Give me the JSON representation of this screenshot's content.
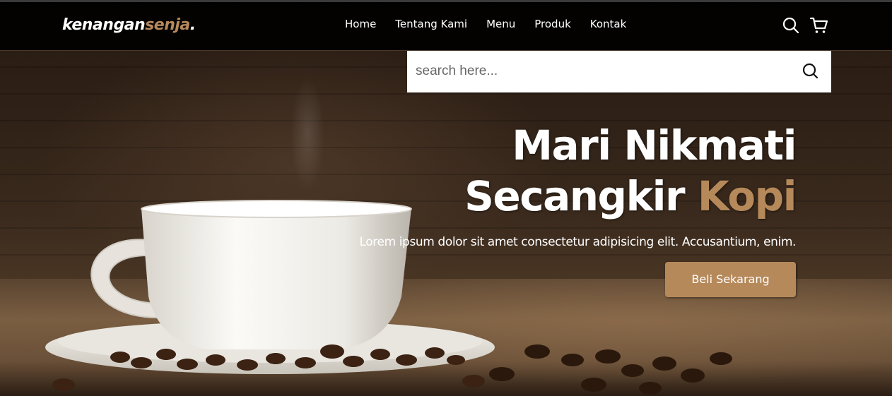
{
  "brand": {
    "name_part1": "kenangan",
    "name_part2": "senja",
    "name_dot": "."
  },
  "nav": {
    "items": [
      {
        "label": "Home"
      },
      {
        "label": "Tentang Kami"
      },
      {
        "label": "Menu"
      },
      {
        "label": "Produk"
      },
      {
        "label": "Kontak"
      }
    ],
    "icons": [
      "search-icon",
      "cart-icon"
    ]
  },
  "search": {
    "placeholder": "search here...",
    "value": ""
  },
  "hero": {
    "headline_line1": "Mari Nikmati",
    "headline_line2_plain": "Secangkir ",
    "headline_line2_accent": "Kopi",
    "description": "Lorem ipsum dolor sit amet consectetur adipisicing elit. Accusantium, enim.",
    "cta_label": "Beli Sekarang"
  },
  "colors": {
    "accent": "#b6895b",
    "navbar": "#000000",
    "text": "#ffffff"
  }
}
